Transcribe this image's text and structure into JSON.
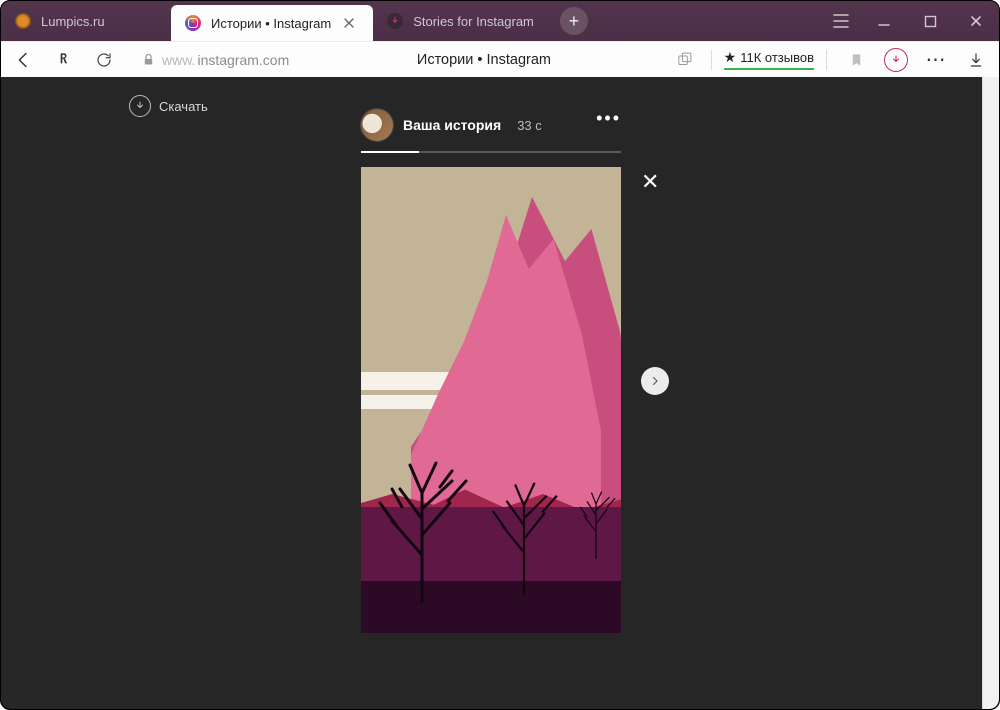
{
  "tabs": {
    "items": [
      {
        "label": "Lumpics.ru"
      },
      {
        "label": "Истории • Instagram"
      },
      {
        "label": "Stories for Instagram"
      }
    ]
  },
  "toolbar": {
    "domain_prefix": "www.",
    "domain_main": "instagram.com",
    "page_title": "Истории • Instagram",
    "reviews_label": "11К отзывов"
  },
  "page": {
    "download_label": "Скачать",
    "story_user": "Ваша история",
    "story_time": "33 с"
  }
}
